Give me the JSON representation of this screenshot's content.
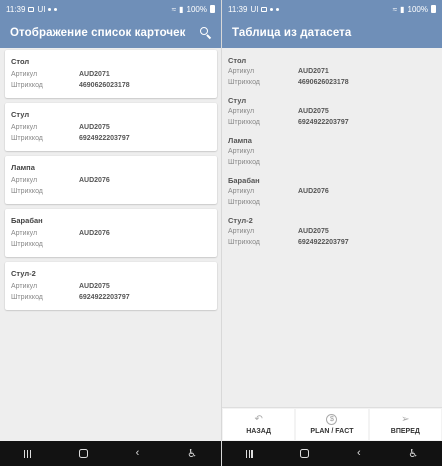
{
  "left": {
    "status": {
      "time": "11:39",
      "carrier": "UI",
      "battery": "100%"
    },
    "app_title": "Отображение список карточек",
    "cards": [
      {
        "name": "Стол",
        "article_label": "Артикул",
        "article": "AUD2071",
        "barcode_label": "Штрихкод",
        "barcode": "4690626023178"
      },
      {
        "name": "Стул",
        "article_label": "Артикул",
        "article": "AUD2075",
        "barcode_label": "Штрихкод",
        "barcode": "6924922203797"
      },
      {
        "name": "Лампа",
        "article_label": "Артикул",
        "article": "AUD2076",
        "barcode_label": "Штрихкод",
        "barcode": ""
      },
      {
        "name": "Барабан",
        "article_label": "Артикул",
        "article": "AUD2076",
        "barcode_label": "Штрихкод",
        "barcode": ""
      },
      {
        "name": "Стул-2",
        "article_label": "Артикул",
        "article": "AUD2075",
        "barcode_label": "Штрихкод",
        "barcode": "6924922203797"
      }
    ]
  },
  "right": {
    "status": {
      "time": "11:39",
      "carrier": "UI",
      "battery": "100%"
    },
    "app_title": "Таблица из датасета",
    "items": [
      {
        "name": "Стол",
        "article_label": "Артикул",
        "article": "AUD2071",
        "barcode_label": "Штрихкод",
        "barcode": "4690626023178"
      },
      {
        "name": "Стул",
        "article_label": "Артикул",
        "article": "AUD2075",
        "barcode_label": "Штрихкод",
        "barcode": "6924922203797"
      },
      {
        "name": "Лампа",
        "article_label": "Артикул",
        "article": "",
        "barcode_label": "Штрихкод",
        "barcode": ""
      },
      {
        "name": "Барабан",
        "article_label": "Артикул",
        "article": "AUD2076",
        "barcode_label": "Штрихкод",
        "barcode": ""
      },
      {
        "name": "Стул-2",
        "article_label": "Артикул",
        "article": "AUD2075",
        "barcode_label": "Штрихкод",
        "barcode": "6924922203797"
      }
    ],
    "buttons": {
      "back": "НАЗАД",
      "plan": "PLAN / FACT",
      "forward": "ВПЕРЕД"
    }
  },
  "icons": {
    "search": "search-icon",
    "back": "back-arrow-icon",
    "plan": "money-icon",
    "forward": "send-icon",
    "nav_recent": "recent-apps-icon",
    "nav_home": "home-icon",
    "nav_back": "nav-back-icon",
    "nav_accessibility": "accessibility-icon"
  },
  "colors": {
    "appbar": "#6f8fb8",
    "navbar": "#121212",
    "background": "#eeeeee"
  }
}
